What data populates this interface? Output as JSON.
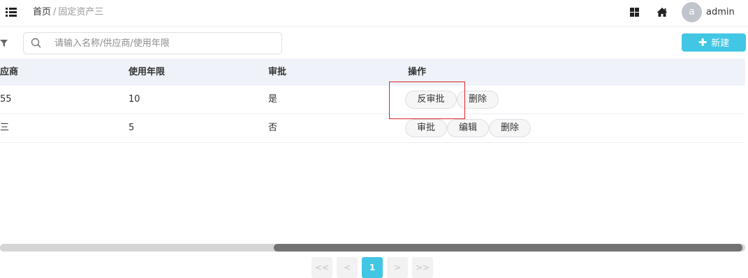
{
  "header": {
    "breadcrumb_home": "首页",
    "breadcrumb_separator": "/",
    "breadcrumb_current": "固定资产三",
    "avatar_letter": "a",
    "username": "admin",
    "icons": [
      "menu-icon",
      "grid-icon",
      "home-icon"
    ]
  },
  "toolbar": {
    "search_placeholder": "请输入名称/供应商/使用年限",
    "search_value": "",
    "new_label": "新建",
    "new_icon": "plus",
    "accent_color": "#41c6e4"
  },
  "table": {
    "columns": [
      "应商",
      "使用年限",
      "审批",
      "操作"
    ],
    "rows": [
      {
        "supplier": "55",
        "years": "10",
        "approved": "是",
        "actions": [
          "反审批",
          "删除"
        ]
      },
      {
        "supplier": "三",
        "years": "5",
        "approved": "否",
        "actions": [
          "审批",
          "编辑",
          "删除"
        ]
      }
    ]
  },
  "pagination": {
    "first": "<<",
    "prev": "<",
    "current": "1",
    "next": ">",
    "last": ">>"
  },
  "colors": {
    "highlight_box": "#d9242a",
    "header_row_bg": "#eff3f9",
    "scroll_thumb": "#737373"
  }
}
